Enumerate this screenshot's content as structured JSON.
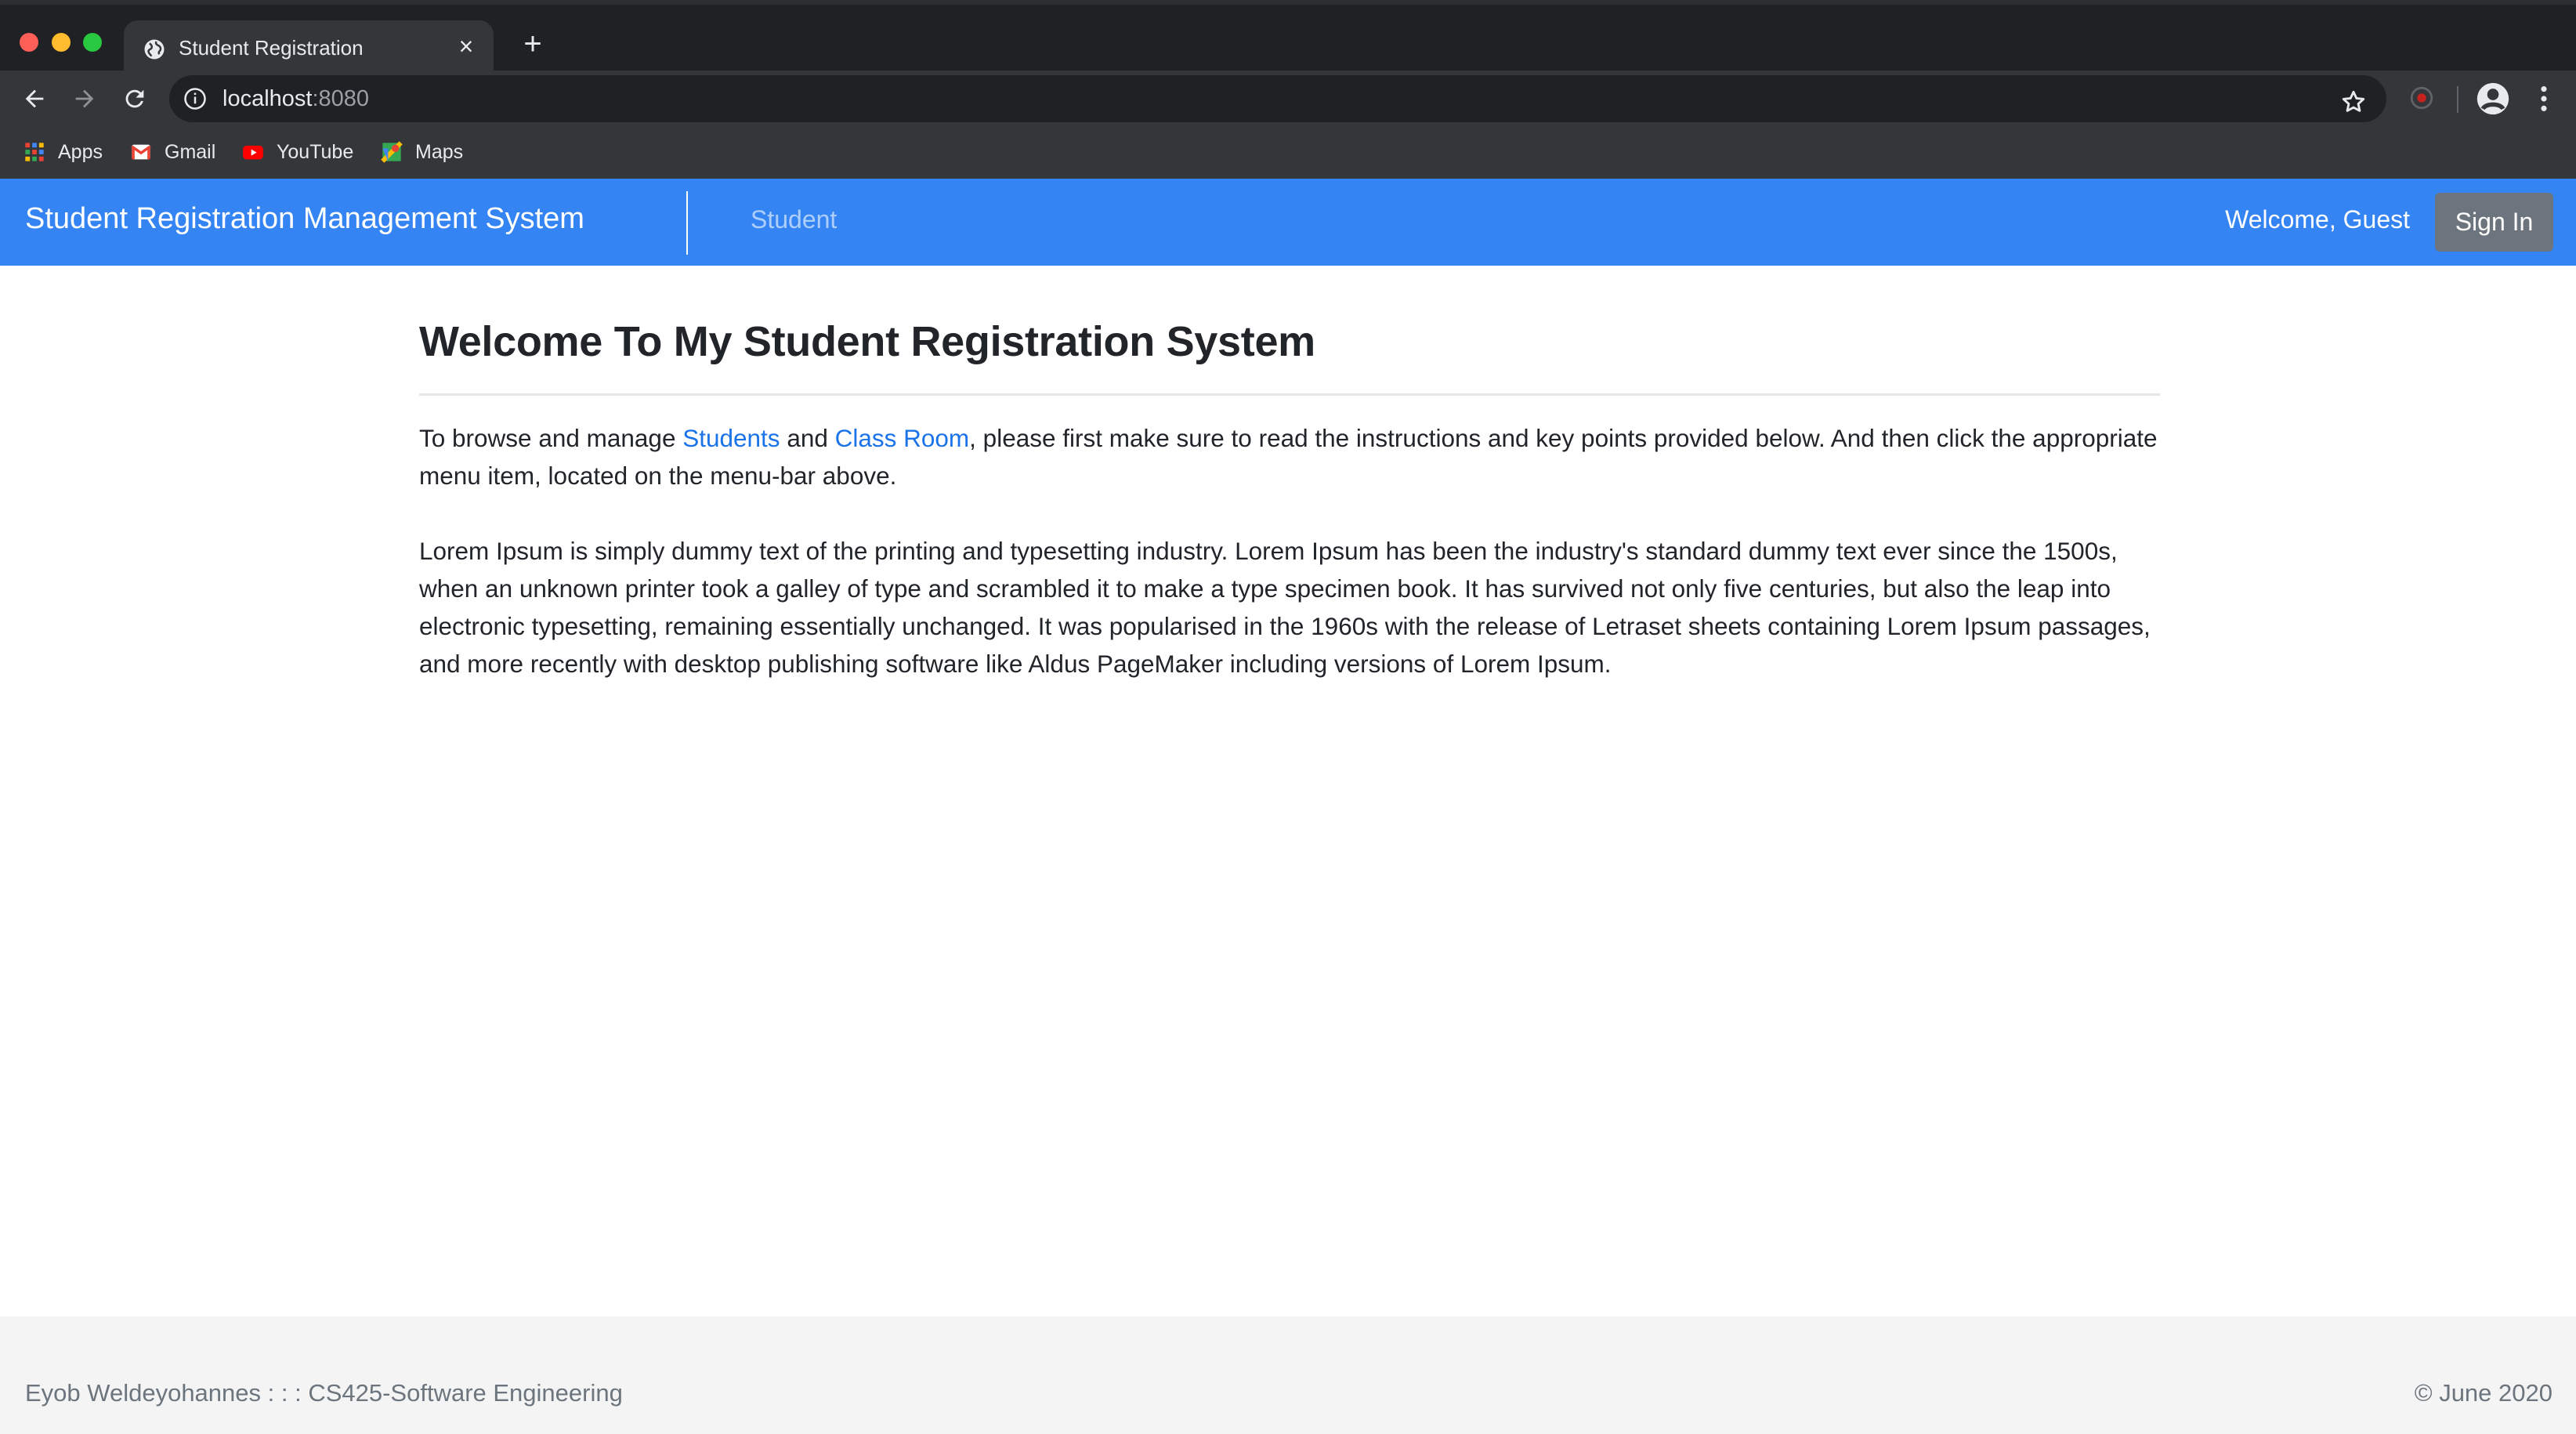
{
  "browser": {
    "tab_title": "Student Registration",
    "tab_close": "×",
    "new_tab": "+",
    "url_host": "localhost",
    "url_port": ":8080",
    "bookmarks": [
      {
        "label": "Apps",
        "icon": "apps-grid-icon"
      },
      {
        "label": "Gmail",
        "icon": "gmail-icon"
      },
      {
        "label": "YouTube",
        "icon": "youtube-icon"
      },
      {
        "label": "Maps",
        "icon": "maps-icon"
      }
    ]
  },
  "navbar": {
    "brand": "Student Registration Management System",
    "student_link": "Student",
    "welcome": "Welcome, Guest",
    "signin_label": "Sign In",
    "color": "#3484f4"
  },
  "main": {
    "title": "Welcome To My Student Registration System",
    "intro": {
      "before": "To browse and manage ",
      "link_students": "Students",
      "between": " and ",
      "link_classroom": "Class Room",
      "after": ", please first make sure to read the instructions and key points provided below. And then click the appropriate menu item, located on the menu-bar above."
    },
    "lorem": "Lorem Ipsum is simply dummy text of the printing and typesetting industry. Lorem Ipsum has been the industry's standard dummy text ever since the 1500s, when an unknown printer took a galley of type and scrambled it to make a type specimen book. It has survived not only five centuries, but also the leap into electronic typesetting, remaining essentially unchanged. It was popularised in the 1960s with the release of Letraset sheets containing Lorem Ipsum passages, and more recently with desktop publishing software like Aldus PageMaker including versions of Lorem Ipsum."
  },
  "footer": {
    "left": "Eyob Weldeyohannes : : : CS425-Software Engineering",
    "right": "© June 2020"
  }
}
